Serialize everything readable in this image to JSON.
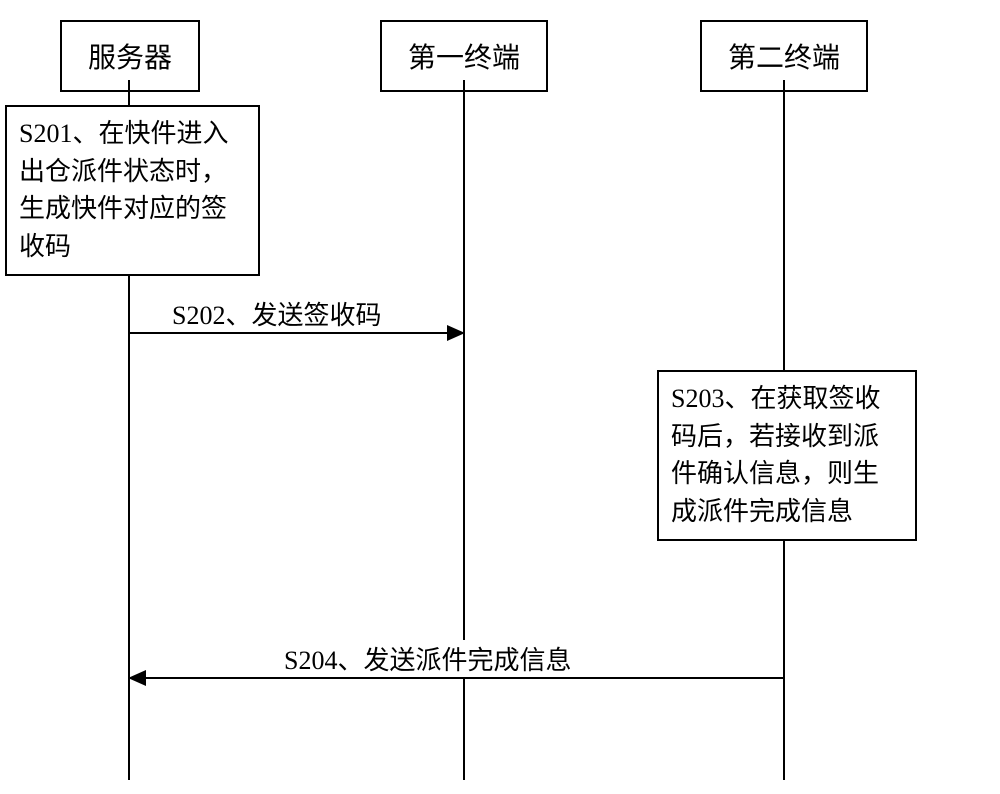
{
  "participants": {
    "server": "服务器",
    "terminal1": "第一终端",
    "terminal2": "第二终端"
  },
  "steps": {
    "s201": "S201、在快件进入出仓派件状态时，生成快件对应的签收码",
    "s202": "S202、发送签收码",
    "s203": "S203、在获取签收码后，若接收到派件确认信息，则生成派件完成信息",
    "s204": "S204、发送派件完成信息"
  },
  "chart_data": {
    "type": "sequence_diagram",
    "participants": [
      "服务器",
      "第一终端",
      "第二终端"
    ],
    "events": [
      {
        "id": "S201",
        "at": "服务器",
        "kind": "process",
        "text": "在快件进入出仓派件状态时，生成快件对应的签收码"
      },
      {
        "id": "S202",
        "from": "服务器",
        "to": "第一终端",
        "kind": "message",
        "text": "发送签收码"
      },
      {
        "id": "S203",
        "at": "第二终端",
        "kind": "process",
        "text": "在获取签收码后，若接收到派件确认信息，则生成派件完成信息"
      },
      {
        "id": "S204",
        "from": "第二终端",
        "to": "服务器",
        "kind": "message",
        "text": "发送派件完成信息"
      }
    ]
  }
}
